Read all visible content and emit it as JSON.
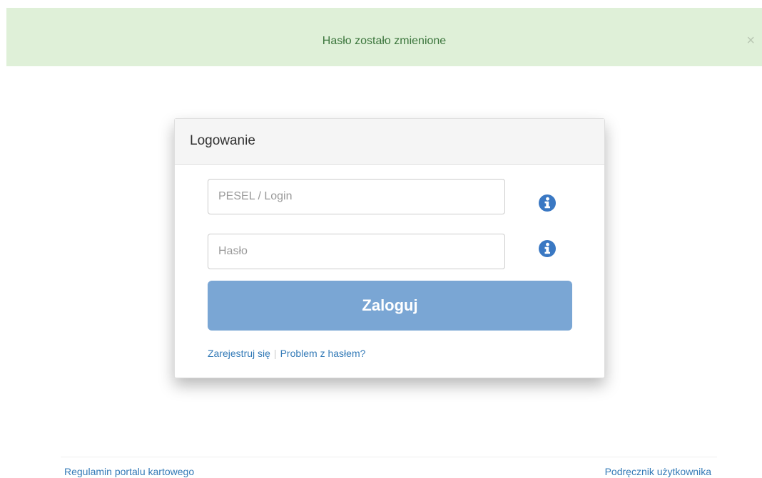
{
  "alert": {
    "message": "Hasło zostało zmienione",
    "close_symbol": "×"
  },
  "login_panel": {
    "title": "Logowanie",
    "login_placeholder": "PESEL / Login",
    "password_placeholder": "Hasło",
    "submit_label": "Zaloguj",
    "register_link": "Zarejestruj się",
    "separator": "|",
    "password_problem_link": "Problem z hasłem?",
    "info_icon": "info-circle-icon"
  },
  "footer": {
    "terms_link": "Regulamin portalu kartowego",
    "manual_link": "Podręcznik użytkownika"
  },
  "colors": {
    "alert_bg": "#dff0d8",
    "alert_text": "#3c763d",
    "button_bg": "#7aa6d4",
    "link": "#337ab7",
    "info_icon": "#3a78c3"
  }
}
